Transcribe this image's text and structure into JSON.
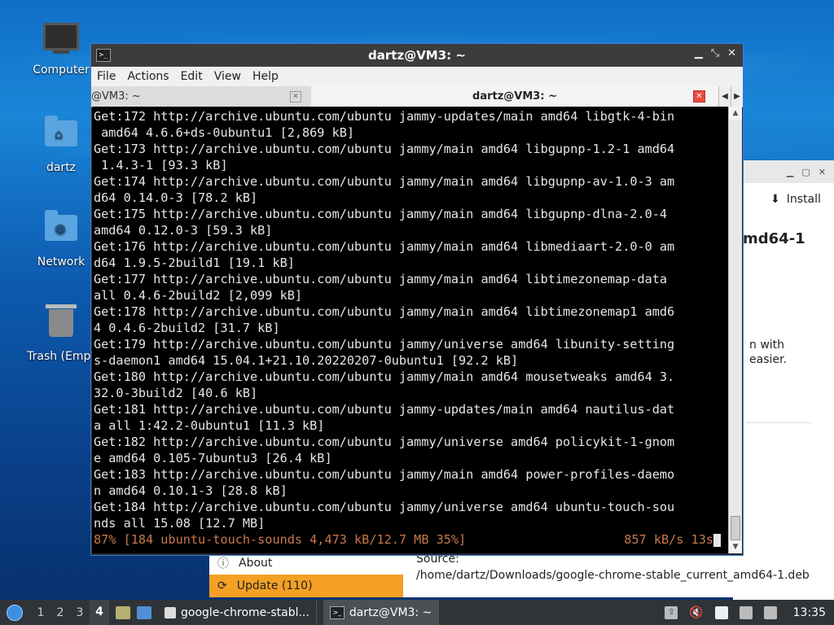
{
  "desktop": {
    "icons": [
      {
        "label": "Computer"
      },
      {
        "label": "dartz"
      },
      {
        "label": "Network"
      },
      {
        "label": "Trash (Empt"
      }
    ]
  },
  "background_app": {
    "install_label": "Install",
    "package_title_fragment": "md64-1",
    "description_line1": "n with",
    "description_line2": "easier.",
    "menu": [
      {
        "label": "About"
      },
      {
        "label": "Update (110)"
      }
    ],
    "source_label": "Source:",
    "source_path": "/home/dartz/Downloads/google-chrome-stable_current_amd64-1.deb"
  },
  "terminal": {
    "window_title": "dartz@VM3: ~",
    "menu": [
      "File",
      "Actions",
      "Edit",
      "View",
      "Help"
    ],
    "tabs": [
      {
        "label": "@VM3: ~"
      },
      {
        "label": "dartz@VM3: ~"
      }
    ],
    "lines": [
      "Get:172 http://archive.ubuntu.com/ubuntu jammy-updates/main amd64 libgtk-4-bin",
      " amd64 4.6.6+ds-0ubuntu1 [2,869 kB]",
      "Get:173 http://archive.ubuntu.com/ubuntu jammy/main amd64 libgupnp-1.2-1 amd64",
      " 1.4.3-1 [93.3 kB]",
      "Get:174 http://archive.ubuntu.com/ubuntu jammy/main amd64 libgupnp-av-1.0-3 am",
      "d64 0.14.0-3 [78.2 kB]",
      "Get:175 http://archive.ubuntu.com/ubuntu jammy/main amd64 libgupnp-dlna-2.0-4",
      "amd64 0.12.0-3 [59.3 kB]",
      "Get:176 http://archive.ubuntu.com/ubuntu jammy/main amd64 libmediaart-2.0-0 am",
      "d64 1.9.5-2build1 [19.1 kB]",
      "Get:177 http://archive.ubuntu.com/ubuntu jammy/main amd64 libtimezonemap-data",
      "all 0.4.6-2build2 [2,099 kB]",
      "Get:178 http://archive.ubuntu.com/ubuntu jammy/main amd64 libtimezonemap1 amd6",
      "4 0.4.6-2build2 [31.7 kB]",
      "Get:179 http://archive.ubuntu.com/ubuntu jammy/universe amd64 libunity-setting",
      "s-daemon1 amd64 15.04.1+21.10.20220207-0ubuntu1 [92.2 kB]",
      "Get:180 http://archive.ubuntu.com/ubuntu jammy/main amd64 mousetweaks amd64 3.",
      "32.0-3build2 [40.6 kB]",
      "Get:181 http://archive.ubuntu.com/ubuntu jammy-updates/main amd64 nautilus-dat",
      "a all 1:42.2-0ubuntu1 [11.3 kB]",
      "Get:182 http://archive.ubuntu.com/ubuntu jammy/universe amd64 policykit-1-gnom",
      "e amd64 0.105-7ubuntu3 [26.4 kB]",
      "Get:183 http://archive.ubuntu.com/ubuntu jammy/main amd64 power-profiles-daemo",
      "n amd64 0.10.1-3 [28.8 kB]",
      "Get:184 http://archive.ubuntu.com/ubuntu jammy/universe amd64 ubuntu-touch-sou",
      "nds all 15.08 [12.7 MB]"
    ],
    "progress_text": "87% [184 ubuntu-touch-sounds 4,473 kB/12.7 MB 35%]",
    "progress_speed": "857 kB/s 13s",
    "progress_color": "#c9784a"
  },
  "taskbar": {
    "workspaces": [
      "1",
      "2",
      "3",
      "4"
    ],
    "active_workspace": "4",
    "tasks": [
      {
        "label": "google-chrome-stabl..."
      },
      {
        "label": "dartz@VM3: ~"
      }
    ],
    "clock": "13:35"
  }
}
